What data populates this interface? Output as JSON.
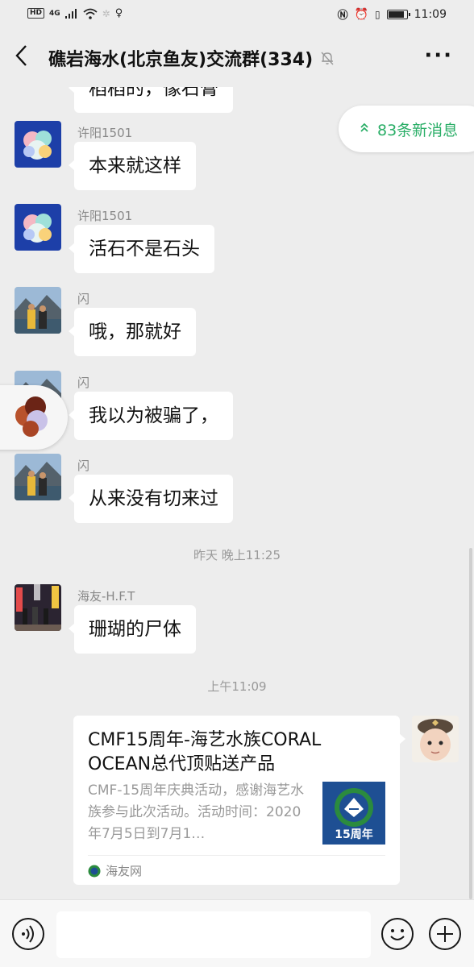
{
  "status_bar": {
    "hd": "HD",
    "network": "4G",
    "time": "11:09"
  },
  "header": {
    "title": "礁岩海水(北京鱼友)交流群(334)"
  },
  "new_messages": {
    "label": "83条新消息"
  },
  "messages": [
    {
      "sender": "",
      "text": "稻稻的，像石膏"
    },
    {
      "sender": "许阳1501",
      "text": "本来就这样"
    },
    {
      "sender": "许阳1501",
      "text": "活石不是石头"
    },
    {
      "sender": "闪",
      "text": "哦，那就好"
    },
    {
      "sender": "闪",
      "text": "我以为被骗了，"
    },
    {
      "sender": "闪",
      "text": "从来没有切来过"
    },
    {
      "sender": "海友-H.F.T",
      "text": "珊瑚的尸体"
    }
  ],
  "timestamps": {
    "yesterday": "昨天 晚上11:25",
    "today": "上午11:09"
  },
  "share_card": {
    "title": "CMF15周年-海艺水族CORAL OCEAN总代顶贴送产品",
    "description": "CMF-15周年庆典活动，感谢海艺水族参与此次活动。活动时间：2020年7月5日到7月1…",
    "thumb_text": "15周年",
    "source": "海友网"
  },
  "colors": {
    "background": "#ededed",
    "accent_green": "#2aae67",
    "bubble": "#ffffff"
  },
  "icons": {
    "back": "back-chevron-icon",
    "mute": "muted-bell-icon",
    "more": "more-dots-icon",
    "voice": "voice-icon",
    "emoji": "emoji-icon",
    "plus": "plus-icon"
  }
}
